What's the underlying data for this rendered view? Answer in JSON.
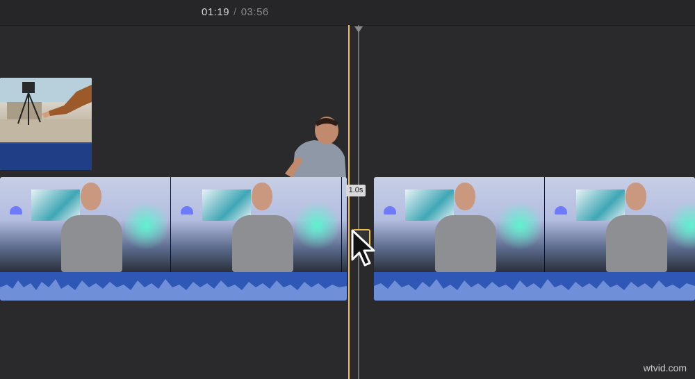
{
  "timecode": {
    "current": "01:19",
    "separator": "/",
    "total": "03:56"
  },
  "transition": {
    "duration_label": "1.0s"
  },
  "watermark": "wtvid.com"
}
